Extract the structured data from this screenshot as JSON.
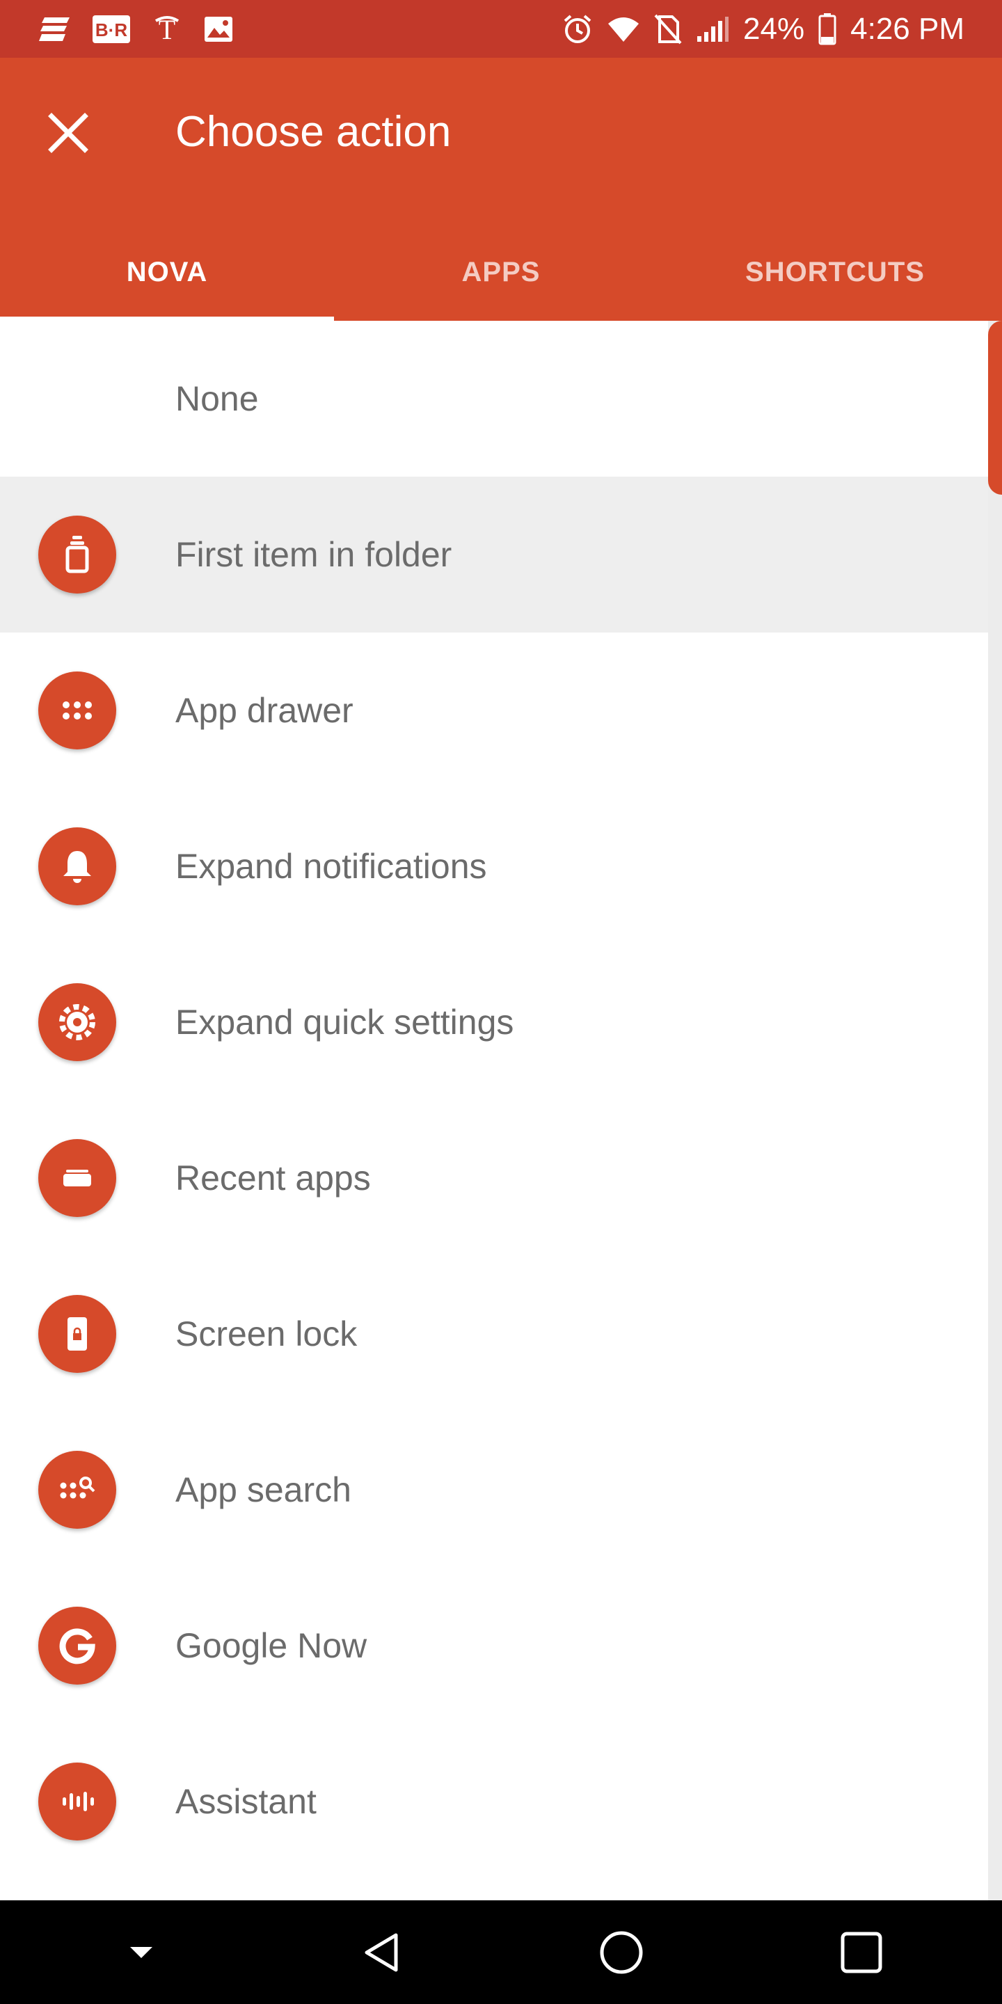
{
  "status_bar": {
    "battery": "24%",
    "time": "4:26 PM",
    "notification_icons": [
      "news-icon",
      "br-icon",
      "nyt-icon",
      "image-icon"
    ],
    "system_icons": [
      "alarm-icon",
      "wifi-icon",
      "no-sim-icon",
      "signal-icon",
      "battery-icon"
    ]
  },
  "app_bar": {
    "title": "Choose action",
    "close_icon": "close-icon",
    "tabs": [
      {
        "label": "NOVA",
        "active": true
      },
      {
        "label": "APPS",
        "active": false
      },
      {
        "label": "SHORTCUTS",
        "active": false
      }
    ]
  },
  "actions": [
    {
      "label": "None",
      "icon": null
    },
    {
      "label": "First item in folder",
      "icon": "folder-item-icon",
      "highlighted": true
    },
    {
      "label": "App drawer",
      "icon": "app-drawer-icon"
    },
    {
      "label": "Expand notifications",
      "icon": "bell-icon"
    },
    {
      "label": "Expand quick settings",
      "icon": "gear-icon"
    },
    {
      "label": "Recent apps",
      "icon": "recent-apps-icon"
    },
    {
      "label": "Screen lock",
      "icon": "screen-lock-icon"
    },
    {
      "label": "App search",
      "icon": "app-search-icon"
    },
    {
      "label": "Google Now",
      "icon": "google-icon"
    },
    {
      "label": "Assistant",
      "icon": "assistant-icon"
    }
  ],
  "nav_bar": {
    "buttons": [
      "hide-nav-icon",
      "back-icon",
      "home-icon",
      "recents-icon"
    ]
  },
  "colors": {
    "accent": "#d64a2a",
    "status_bar": "#c2392a",
    "label_text": "#6b6b6b",
    "highlight_row": "#eeeeee"
  }
}
